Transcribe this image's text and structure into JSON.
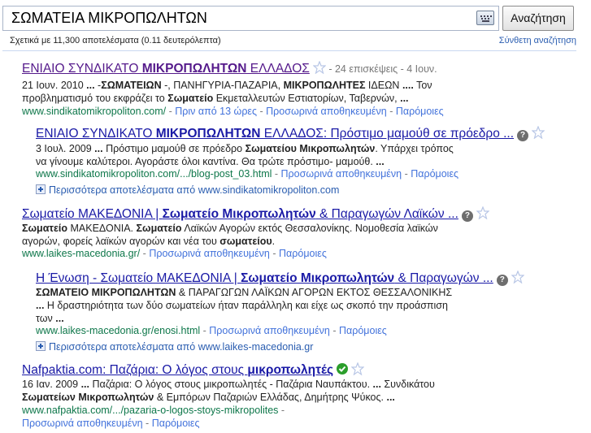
{
  "search": {
    "query": "ΣΩΜΑΤΕΙΑ ΜΙΚΡΟΠΩΛΗΤΩΝ",
    "button_label": "Αναζήτηση",
    "stats": "Σχετικά με 11,300 αποτελέσματα (0.11 δευτερόλεπτα)",
    "advanced_label": "Σύνθετη αναζήτηση"
  },
  "r1": {
    "t1": "ΕΝΙΑΙΟ ΣΥΝΔΙΚΑΤΟ ",
    "t2": "ΜΙΚΡΟΠΩΛΗΤΩΝ",
    "t3": " ΕΛΛΑΔΟΣ",
    "meta": " - 24 επισκέψεις - 4 Ιουν.",
    "s1a": "21 Ιουν. 2010 ",
    "s1b": "...",
    "s1c": " -",
    "s1d": "ΣΩΜΑΤΕΙΩΝ",
    "s1e": " -, ΠΑΝΗΓΥΡΙΑ-ΠΑΖΑΡΙΑ, ",
    "s1f": "ΜΙΚΡΟΠΩΛΗΤΕΣ",
    "s1g": " ΙΔΕΩΝ ",
    "s1h": "....",
    "s1i": " Τον",
    "s2a": "προβληματισμό του εκφράζει το ",
    "s2b": "Σωματείο",
    "s2c": " Εκμεταλλευτών Εστιατορίων, Ταβερνών, ",
    "s2d": "...",
    "url": "www.sindikatomikropoliton.com/",
    "ago": "Πριν από 13 ώρες"
  },
  "r2": {
    "t1": "ΕΝΙΑΙΟ ΣΥΝΔΙΚΑΤΟ ",
    "t2": "ΜΙΚΡΟΠΩΛΗΤΩΝ",
    "t3": " ΕΛΛΑΔΟΣ: Πρόστιμο μαμούθ σε πρόεδρο ...",
    "s1a": "3 Ιουλ. 2009 ",
    "s1b": "...",
    "s1c": " Πρόστιμο μαμούθ σε πρόεδρο ",
    "s1d": "Σωματείου Μικροπωλητών",
    "s1e": ". Υπάρχει τρόπος",
    "s2": "να γίνουμε καλύτεροι. Αγοράστε όλοι καντίνα. Θα τρώτε πρόστιμο- μαμούθ. ",
    "s2b": "...",
    "url": "www.sindikatomikropoliton.com/.../blog-post_03.html",
    "more_prefix": "Περισσότερα αποτελέσματα από ",
    "more_site": "www.sindikatomikropoliton.com"
  },
  "r3": {
    "t1": "Σωματείο ΜΑΚΕΔΟΝΙΑ | ",
    "t2": "Σωματείο Μικροπωλητών",
    "t3": " & Παραγωγών Λαϊκών ...",
    "s1a": "Σωματείο",
    "s1b": " ΜΑΚΕΔΟΝΙΑ. ",
    "s1c": "Σωματείο",
    "s1d": " Λαϊκών Αγορών εκτός Θεσσαλονίκης. Νομοθεσία λαϊκών",
    "s2a": "αγορών, φορείς λαϊκών αγορών και νέα του ",
    "s2b": "σωματείου",
    "s2c": ".",
    "url": "www.laikes-macedonia.gr/"
  },
  "r4": {
    "t1": "Η Ένωση - Σωματείο ΜΑΚΕΔΟΝΙΑ | ",
    "t2": "Σωματείο Μικροπωλητών",
    "t3": " & Παραγωγών ...",
    "s1a": "ΣΩΜΑΤΕΙΟ ΜΙΚΡΟΠΩΛΗΤΩΝ",
    "s1b": " & ΠΑΡΑΓΩΓΩΝ ΛΑΪΚΩΝ ΑΓΟΡΩΝ ΕΚΤΟΣ ΘΕΣΣΑΛΟΝΙΚΗΣ",
    "s2a": "...",
    "s2b": " Η δραστηριότητα των δύο σωματείων ήταν παράλληλη και είχε ως σκοπό την προάσπιση",
    "s3": "των ",
    "s3b": "...",
    "url": "www.laikes-macedonia.gr/enosi.html",
    "more_prefix": "Περισσότερα αποτελέσματα από ",
    "more_site": "www.laikes-macedonia.gr"
  },
  "r5": {
    "t1": "Nafpaktia.com: Παζάρια: Ο λόγος στους ",
    "t2": "μικροπωλητές",
    "s1a": "16 Ιαν. 2009 ",
    "s1b": "...",
    "s1c": " Παζάρια: Ο λόγος στους μικροπωλητές - Παζάρια Ναυπάκτου. ",
    "s1d": "...",
    "s1e": " Συνδικάτου",
    "s2a": "Σωματείων Μικροπωλητών",
    "s2b": " & Εμπόρων Παζαριών Ελλάδας, Δημήτρης Ψύκος. ",
    "s2c": "...",
    "url": "www.nafpaktia.com/.../pazaria-o-logos-stoys-mikropolites",
    "sep": " - "
  },
  "links": {
    "cached": "Προσωρινά αποθηκευμένη",
    "similar": "Παρόμοιες",
    "sep": " - "
  }
}
